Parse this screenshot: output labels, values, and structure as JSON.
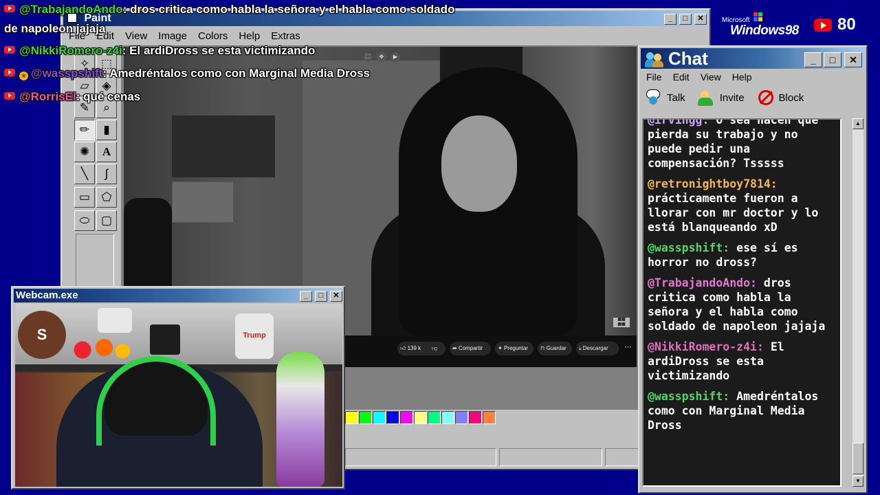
{
  "overlay_chat": [
    {
      "user": "@TrabajandoAndo",
      "text": ": dros critica como habla la señora y el habla como soldado",
      "badge": "youtube-icon",
      "color": "green"
    },
    {
      "user": "",
      "text": "de napoleon jajaja",
      "badge": "",
      "color": ""
    },
    {
      "user": "@NikkiRomero-z4i",
      "text": ": El ardiDross se esta victimizando",
      "badge": "youtube-icon",
      "color": "green"
    },
    {
      "user": "@wasspshift",
      "text": ": Amedréntalos como con Marginal Media Dross",
      "badge": "youtube-icon star-icon",
      "color": "purple"
    },
    {
      "user": "@RorrisEl",
      "text": ": qué cenas",
      "badge": "youtube-icon",
      "color": "pink"
    }
  ],
  "paint": {
    "title": "Paint",
    "menu": [
      "File",
      "Edit",
      "View",
      "Image",
      "Colors",
      "Help",
      "Extras"
    ],
    "palette": [
      "#ffff00",
      "#00ff00",
      "#00ffff",
      "#0000ff",
      "#ff00ff",
      "#ffff80",
      "#00ff80",
      "#80ffff",
      "#8080ff",
      "#ff0080",
      "#ff8040"
    ]
  },
  "video": {
    "likes": "139 k",
    "share": "Compartir",
    "ask": "Preguntar",
    "save": "Guardar",
    "download": "Descargar"
  },
  "windows_logo": {
    "brand": "Microsoft",
    "name": "Windows98"
  },
  "viewers": {
    "count": "80",
    "icon": "youtube-icon"
  },
  "chat": {
    "title": "Chat",
    "menu": [
      "File",
      "Edit",
      "View",
      "Help"
    ],
    "tools": [
      {
        "label": "Talk",
        "icon": "talk-icon"
      },
      {
        "label": "Invite",
        "icon": "invite-icon"
      },
      {
        "label": "Block",
        "icon": "block-icon"
      }
    ],
    "messages": [
      {
        "user": "@irvingg:",
        "text": " O sea hacen que pierda su trabajo y no puede pedir una compensación? Tsssss",
        "color": "#c9a6f5"
      },
      {
        "user": "@retronightboy7814:",
        "text": " prácticamente fueron a llorar con mr doctor y lo está blanqueando xD",
        "color": "#f2b84c"
      },
      {
        "user": "@wasspshift:",
        "text": " ese sí es horror no dross?",
        "color": "#4cd964"
      },
      {
        "user": "@TrabajandoAndo:",
        "text": " dros critica como habla la señora y el habla como soldado de napoleon jajaja",
        "color": "#e07ad0"
      },
      {
        "user": "@NikkiRomero-z4i:",
        "text": " El ardiDross se esta victimizando",
        "color": "#e06ec0"
      },
      {
        "user": "@wasspshift:",
        "text": " Amedréntalos como con Marginal Media Dross",
        "color": "#4cd964"
      }
    ]
  },
  "webcam": {
    "title": "Webcam.exe",
    "shirt_text": "Trump",
    "ball_letter": "S"
  }
}
